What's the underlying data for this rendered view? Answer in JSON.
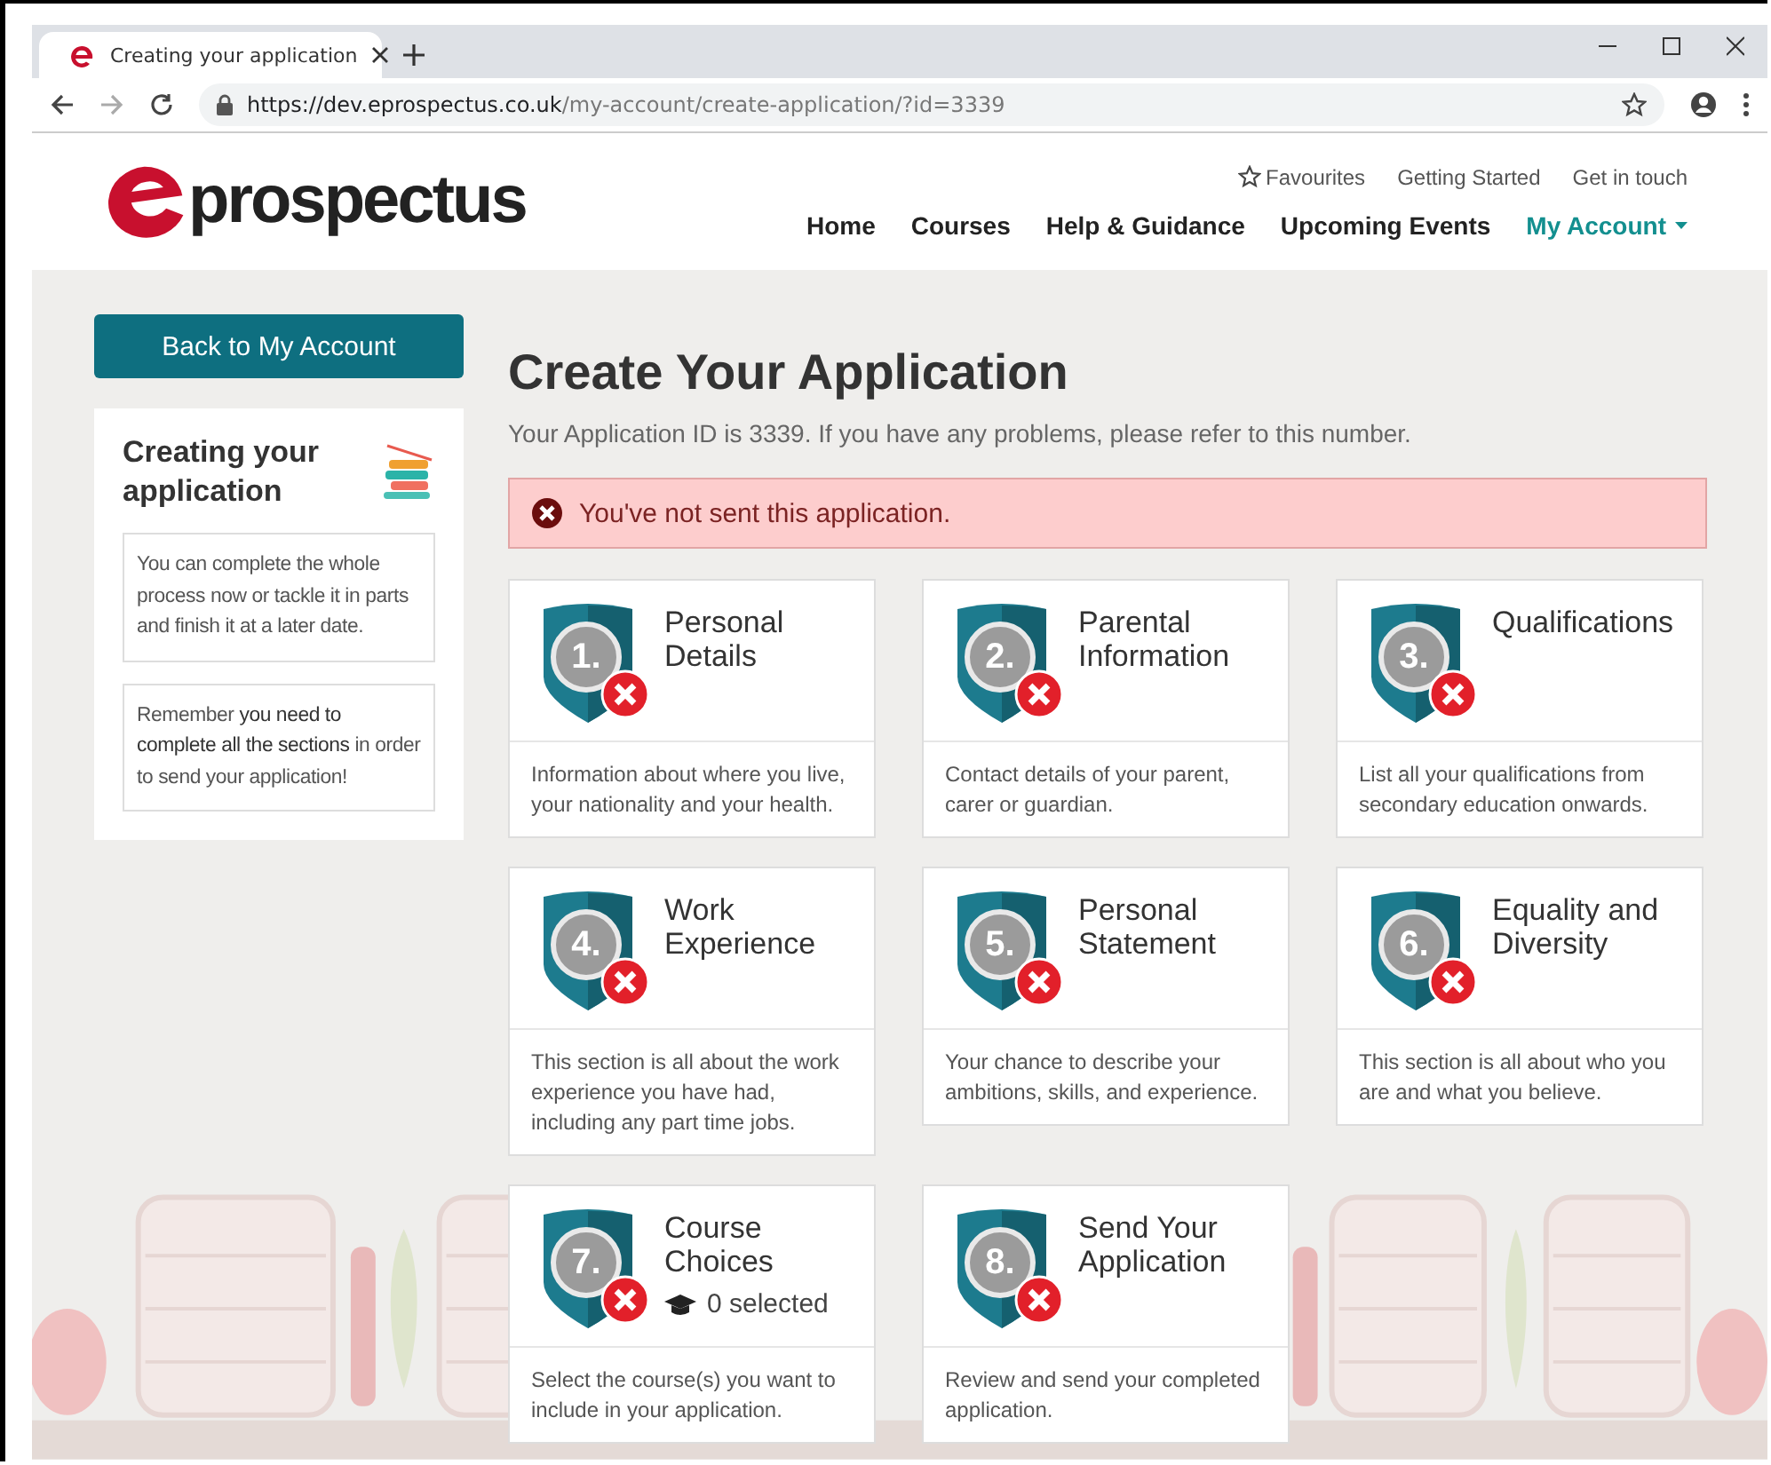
{
  "browser": {
    "tab_title": "Creating your application",
    "url": {
      "host": "https://dev.eprospectus.co.uk",
      "path": "/my-account/create-application/?id=3339"
    }
  },
  "header": {
    "logo_text": "prospectus",
    "top_links": [
      {
        "label": "Favourites",
        "kind": "star"
      },
      {
        "label": "Getting Started",
        "kind": "plain"
      },
      {
        "label": "Get in touch",
        "kind": "plain"
      }
    ],
    "nav": [
      {
        "label": "Home",
        "selected": false
      },
      {
        "label": "Courses",
        "selected": false
      },
      {
        "label": "Help & Guidance",
        "selected": false
      },
      {
        "label": "Upcoming Events",
        "selected": false
      },
      {
        "label": "My Account",
        "selected": true
      }
    ]
  },
  "sidebar": {
    "back_button": "Back to My Account",
    "title": "Creating your application",
    "notes": [
      "You can complete the whole process now or tackle it in parts and finish it at a later date.",
      "Remember **you need to complete all the sections** in order to send your application!"
    ]
  },
  "main": {
    "title": "Create Your Application",
    "subtitle": "Your Application ID is 3339. If you have any problems, please refer to this number.",
    "alert": "You've not sent this application.",
    "cards": [
      {
        "number": "1.",
        "title": "Personal Details",
        "complete": false,
        "description": "Information about where you live, your nationality and your health."
      },
      {
        "number": "2.",
        "title": "Parental Information",
        "complete": false,
        "description": "Contact details of your parent, carer or guardian."
      },
      {
        "number": "3.",
        "title": "Qualifications",
        "complete": false,
        "description": "List all your qualifications from secondary education onwards."
      },
      {
        "number": "4.",
        "title": "Work Experience",
        "complete": false,
        "description": "This section is all about the work experience you have had, including any part time jobs."
      },
      {
        "number": "5.",
        "title": "Personal Statement",
        "complete": false,
        "description": "Your chance to describe your ambitions, skills, and experience."
      },
      {
        "number": "6.",
        "title": "Equality and Diversity",
        "complete": false,
        "description": "This section is all about who you are and what you believe."
      },
      {
        "number": "7.",
        "title": "Course Choices",
        "complete": false,
        "count": "0 selected",
        "description": "Select the course(s) you want to include in your application."
      },
      {
        "number": "8.",
        "title": "Send Your Application",
        "complete": false,
        "description": "Review and send your completed application."
      }
    ]
  }
}
